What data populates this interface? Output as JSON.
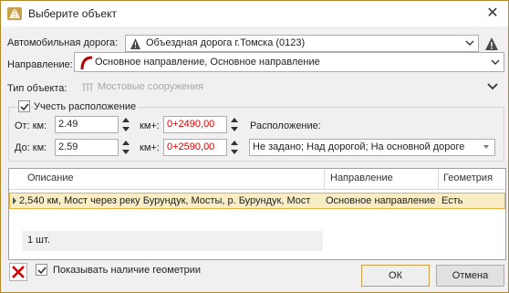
{
  "window": {
    "title": "Выберите объект",
    "icon": "road-sign-icon"
  },
  "form": {
    "road_label": "Автомобильная дорога:",
    "road_value": "Объездная дорога г.Томска (0123)",
    "direction_label": "Направление:",
    "direction_value": "Основное направление, Основное направление",
    "object_type_label": "Тип объекта:",
    "object_type_value": "Мостовые сооружения"
  },
  "location": {
    "checkbox_label": "Учесть расположение",
    "checked": true,
    "from_label": "От: км:",
    "from_km": "2.49",
    "from_kmplus_label": "км+:",
    "from_kmplus": "0+2490,00",
    "to_label": "До: км:",
    "to_km": "2.59",
    "to_kmplus_label": "км+:",
    "to_kmplus": "0+2590,00",
    "placement_label": "Расположение:",
    "placement_value": "Не задано; Над дорогой; На основной дороге"
  },
  "grid": {
    "columns": [
      "Описание",
      "Направление",
      "Геометрия"
    ],
    "rows": [
      {
        "description": "2,540 км, Мост через реку Бурундук, Мосты, р. Бурундук, Мост",
        "direction": "Основное направление",
        "geometry": "Есть"
      }
    ],
    "count_text": "1 шт."
  },
  "footer": {
    "show_geometry_label": "Показывать наличие геометрии",
    "show_geometry_checked": true,
    "ok_label": "ОК",
    "cancel_label": "Отмена"
  },
  "colors": {
    "accent": "#c9a048",
    "selected_row": "#f8edc4",
    "red_value": "#d40000"
  }
}
